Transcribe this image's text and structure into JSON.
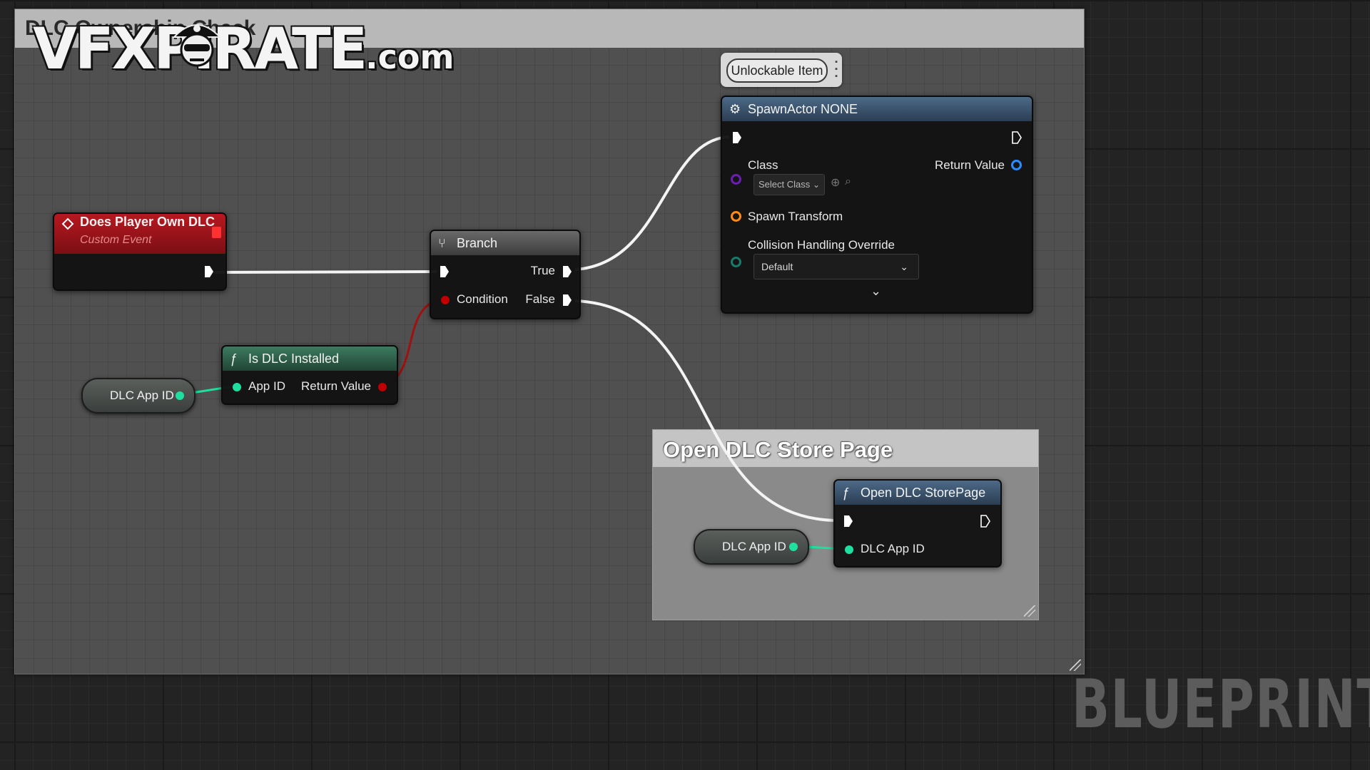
{
  "comment": {
    "title": "DLC Ownership Check"
  },
  "group": {
    "title": "Open DLC Store Page"
  },
  "watermark": {
    "brand": "VFXPIRATE",
    "suffix": ".com",
    "corner": "BLUEPRINT"
  },
  "tag": {
    "label": "Unlockable Item"
  },
  "event_node": {
    "title": "Does Player Own DLC",
    "subtitle": "Custom Event"
  },
  "branch_node": {
    "title": "Branch",
    "condition": "Condition",
    "true_label": "True",
    "false_label": "False"
  },
  "is_dlc_node": {
    "title": "Is DLC Installed",
    "app_id": "App ID",
    "return_value": "Return Value"
  },
  "var_dlc_1": {
    "label": "DLC App ID"
  },
  "var_dlc_2": {
    "label": "DLC App ID"
  },
  "spawn_node": {
    "title": "SpawnActor NONE",
    "class_label": "Class",
    "class_select": "Select Class",
    "return_value": "Return Value",
    "spawn_transform": "Spawn Transform",
    "collision_label": "Collision Handling Override",
    "collision_value": "Default"
  },
  "store_node": {
    "title": "Open DLC StorePage",
    "dlc_app_id": "DLC App ID"
  },
  "colors": {
    "exec": "#ffffff",
    "bool_pin": "#c00000",
    "int_pin": "#1de0a0",
    "object_pin": "#2a8cff",
    "struct_pin": "#ff8a1a",
    "class_pin": "#6a1fb0",
    "event_header": "#a0141a",
    "function_header": "#2c5a48",
    "spawn_header": "#3b5470"
  }
}
